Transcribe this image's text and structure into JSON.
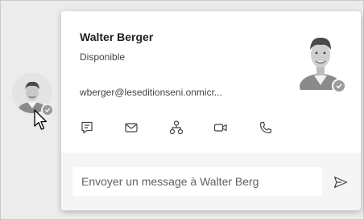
{
  "contact": {
    "name": "Walter Berger",
    "presence": "Disponible",
    "email": "wberger@leseditionseni.onmicr..."
  },
  "actions": [
    {
      "name": "chat",
      "icon": "chat-icon"
    },
    {
      "name": "email",
      "icon": "mail-icon"
    },
    {
      "name": "org-chart",
      "icon": "org-chart-icon"
    },
    {
      "name": "video-call",
      "icon": "video-call-icon"
    },
    {
      "name": "audio-call",
      "icon": "phone-icon"
    }
  ],
  "message": {
    "placeholder": "Envoyer un message à Walter Berg"
  },
  "colors": {
    "presence_badge": "#9b9b9b",
    "icon": "#424242"
  }
}
